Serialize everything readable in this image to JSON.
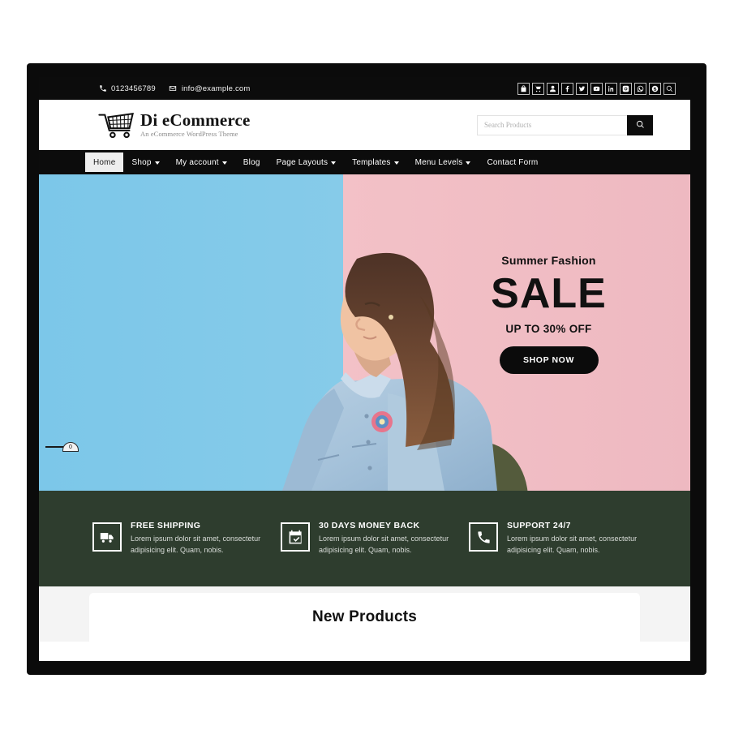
{
  "topbar": {
    "phone": "0123456789",
    "email": "info@example.com",
    "phone_icon": "phone-icon",
    "email_icon": "envelope-icon",
    "social": [
      {
        "name": "bag-icon",
        "label": "Bag"
      },
      {
        "name": "cart-icon",
        "label": "Cart"
      },
      {
        "name": "user-icon",
        "label": "Account"
      },
      {
        "name": "facebook-icon",
        "label": "Facebook"
      },
      {
        "name": "twitter-icon",
        "label": "Twitter"
      },
      {
        "name": "youtube-icon",
        "label": "YouTube"
      },
      {
        "name": "linkedin-icon",
        "label": "LinkedIn"
      },
      {
        "name": "instagram-icon",
        "label": "Instagram"
      },
      {
        "name": "whatsapp-icon",
        "label": "WhatsApp"
      },
      {
        "name": "skype-icon",
        "label": "Skype"
      },
      {
        "name": "search-icon",
        "label": "Search"
      }
    ]
  },
  "brand": {
    "title": "Di eCommerce",
    "tagline": "An eCommerce WordPress Theme",
    "logo_icon": "shopping-cart-icon"
  },
  "search": {
    "placeholder": "Search Products",
    "value": "",
    "button_icon": "search-icon"
  },
  "nav": {
    "items": [
      {
        "label": "Home",
        "caret": false,
        "active": true
      },
      {
        "label": "Shop",
        "caret": true,
        "active": false
      },
      {
        "label": "My account",
        "caret": true,
        "active": false
      },
      {
        "label": "Blog",
        "caret": false,
        "active": false
      },
      {
        "label": "Page Layouts",
        "caret": true,
        "active": false
      },
      {
        "label": "Templates",
        "caret": true,
        "active": false
      },
      {
        "label": "Menu Levels",
        "caret": true,
        "active": false
      },
      {
        "label": "Contact Form",
        "caret": false,
        "active": false
      }
    ]
  },
  "hero": {
    "eyebrow": "Summer Fashion",
    "headline": "SALE",
    "subline": "UP TO 30% OFF",
    "cta": "SHOP NOW",
    "slide_number": "0",
    "colors": {
      "left": "#7ec8e8",
      "right": "#f0bcc3"
    }
  },
  "features": [
    {
      "icon": "truck-icon",
      "title": "FREE SHIPPING",
      "desc": "Lorem ipsum dolor sit amet, consectetur adipisicing elit. Quam, nobis."
    },
    {
      "icon": "calendar-check-icon",
      "title": "30 DAYS MONEY BACK",
      "desc": "Lorem ipsum dolor sit amet, consectetur adipisicing elit. Quam, nobis."
    },
    {
      "icon": "phone-icon",
      "title": "SUPPORT 24/7",
      "desc": "Lorem ipsum dolor sit amet, consectetur adipisicing elit. Quam, nobis."
    }
  ],
  "products": {
    "title": "New Products"
  }
}
